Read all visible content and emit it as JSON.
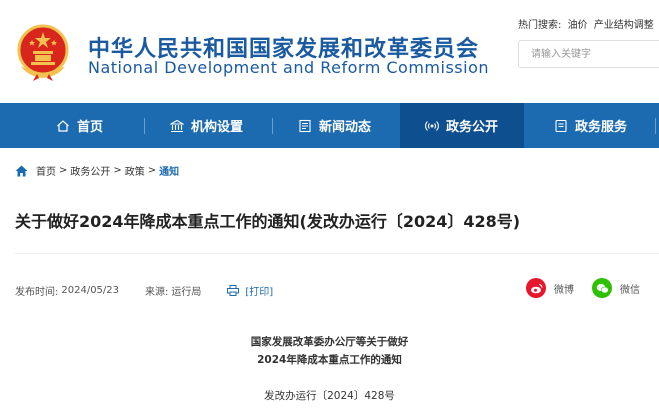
{
  "header": {
    "title_cn": "中华人民共和国国家发展和改革委员会",
    "title_en": "National Development and Reform Commission",
    "hot_search_label": "热门搜索:",
    "hot_search_keywords": [
      "油价",
      "产业结构调整"
    ],
    "search_placeholder": "请输入关键字"
  },
  "nav": {
    "items": [
      {
        "label": "首页",
        "icon": "home-icon"
      },
      {
        "label": "机构设置",
        "icon": "institution-icon"
      },
      {
        "label": "新闻动态",
        "icon": "news-icon"
      },
      {
        "label": "政务公开",
        "icon": "broadcast-icon",
        "active": true
      },
      {
        "label": "政务服务",
        "icon": "service-icon"
      }
    ]
  },
  "breadcrumb": {
    "items": [
      "首页",
      "政务公开",
      "政策"
    ],
    "separator": ">",
    "current": "通知"
  },
  "article": {
    "title": "关于做好2024年降成本重点工作的通知(发改办运行〔2024〕428号)",
    "publish_label": "发布时间:",
    "publish_date": "2024/05/23",
    "source_label": "来源:",
    "source": "运行局",
    "print_label": "[打印]",
    "share": [
      {
        "label": "微博",
        "icon": "weibo-icon"
      },
      {
        "label": "微信",
        "icon": "wechat-icon"
      }
    ],
    "doc_heading_line1": "国家发展改革委办公厅等关于做好",
    "doc_heading_line2": "2024年降成本重点工作的通知",
    "doc_number": "发改办运行〔2024〕428号"
  },
  "colors": {
    "brand_blue": "#1c6bb1",
    "nav_active": "#0d4f8f",
    "emblem_red": "#d8261c",
    "emblem_gold": "#f2c14e",
    "weibo_red": "#e6162d",
    "wechat_green": "#2dc100"
  }
}
